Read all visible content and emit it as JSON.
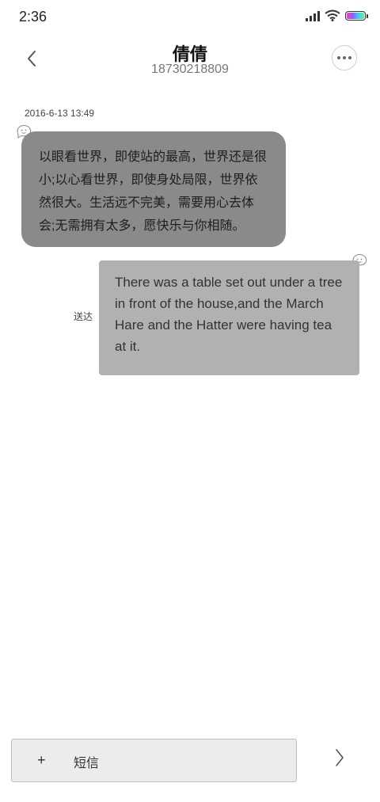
{
  "status_bar": {
    "time": "2:36",
    "icons": [
      "signal-icon",
      "wifi-icon",
      "battery-icon"
    ]
  },
  "header": {
    "contact_name": "倩倩",
    "contact_number": "18730218809",
    "back_icon": "chevron-left-icon",
    "more_icon": "more-dots-icon"
  },
  "conversation": {
    "timestamp": "2016-6-13 13:49",
    "messages": [
      {
        "direction": "incoming",
        "lines": [
          "以眼看世界，即使站的最高，世界还是很",
          "小;以心看世界，即使身处局限，世界依",
          "然很大。生活远不完美，需要用心去体",
          "会;无需拥有太多，愿快乐与你相随。"
        ]
      },
      {
        "direction": "outgoing",
        "lines": [
          "There was a table set out under a tree",
          "in front of the house,and the March",
          "Hare and the Hatter were having tea",
          "at it."
        ],
        "status": "送达"
      }
    ]
  },
  "compose": {
    "plus_label": "+",
    "placeholder": "短信",
    "send_icon": "chevron-right-icon"
  },
  "colors": {
    "incoming_bubble": "#8a8a8a",
    "outgoing_bubble": "#b1b1b1",
    "compose_bg": "#ececec"
  }
}
